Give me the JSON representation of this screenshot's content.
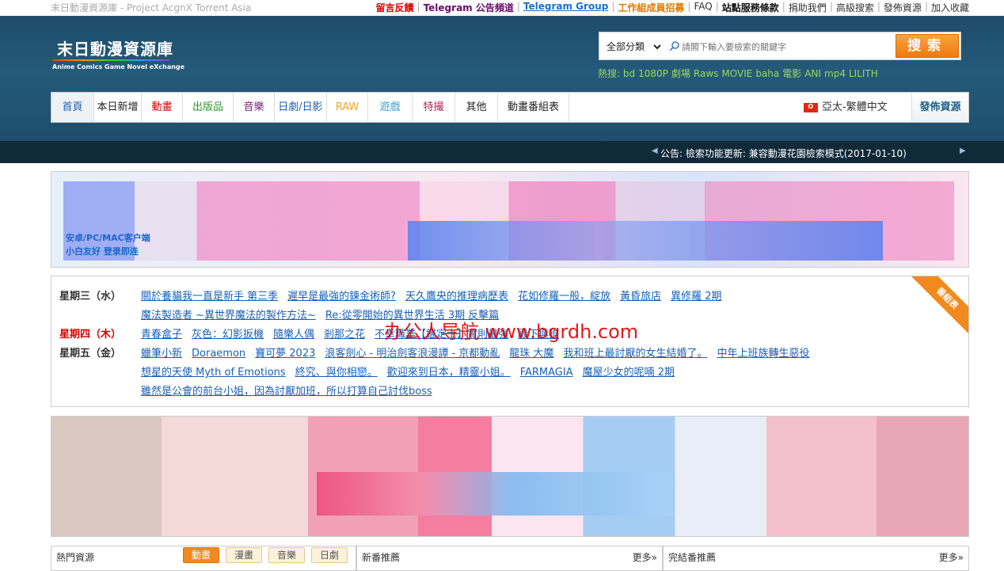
{
  "topbar": {
    "site_title": "末日動漫資源庫 - Project AcgnX Torrent Asia",
    "links": [
      {
        "label": "留言反饋",
        "style": "red"
      },
      {
        "label": "Telegram 公告頻道",
        "style": "purple"
      },
      {
        "label": "Telegram Group",
        "style": "blue"
      },
      {
        "label": "工作組成員招募",
        "style": "orange"
      },
      {
        "label": "FAQ",
        "style": "normal"
      },
      {
        "label": "站點服務條款",
        "style": "strong"
      },
      {
        "label": "捐助我們",
        "style": "normal"
      },
      {
        "label": "高級搜索",
        "style": "normal"
      },
      {
        "label": "發佈資源",
        "style": "normal"
      },
      {
        "label": "加入收藏",
        "style": "normal"
      }
    ]
  },
  "header": {
    "logo_cn": "末日動漫資源庫",
    "logo_en": "Anime Comics Game Novel eXchange",
    "search": {
      "category": "全部分類",
      "placeholder": "請閣下輸入要檢索的關鍵字",
      "button": "搜索"
    },
    "hot_label": "熱搜:",
    "hot_words": [
      "bd",
      "1080P",
      "劇場",
      "Raws",
      "MOVIE",
      "baha",
      "電影",
      "ANI",
      "mp4",
      "LILITH"
    ]
  },
  "nav": {
    "items": [
      {
        "label": "首頁",
        "color": "#1a5fb4"
      },
      {
        "label": "本日新增",
        "color": "#222222"
      },
      {
        "label": "動畫",
        "color": "#d00000"
      },
      {
        "label": "出版品",
        "color": "#2a9a2a"
      },
      {
        "label": "音樂",
        "color": "#7a1f7a"
      },
      {
        "label": "日劇/日影",
        "color": "#1a5fb4"
      },
      {
        "label": "RAW",
        "color": "#f5a623"
      },
      {
        "label": "遊戲",
        "color": "#3aa0d8"
      },
      {
        "label": "特撮",
        "color": "#b0224a"
      },
      {
        "label": "其他",
        "color": "#222222"
      },
      {
        "label": "動畫番組表",
        "color": "#222222"
      }
    ],
    "language": "亞太-繁體中文",
    "publish": "發佈資源"
  },
  "announcement": "公告: 檢索功能更新: 兼容動漫花園檢索模式(2017-01-10)",
  "banner1": {
    "client_line1": "安卓/PC/MAC客户端",
    "client_line2": "小白友好 登录即连"
  },
  "schedule": {
    "ribbon": "番組表",
    "watermark": "办公人导航 www.bgrdh.com",
    "days": [
      {
        "day": "星期三（水）",
        "today": false,
        "lines": [
          [
            "關於養貓我一直是新手 第三季",
            "遲早是最強的鍊金術師?",
            "天久鷹央的推理病歷表",
            "花如修羅一般，綻放",
            "黃昏旅店",
            "異修羅 2期"
          ],
          [
            "魔法製造者 ~異世界魔法的製作方法~",
            "Re:從零開始的異世界生活 3期 反擊篇"
          ]
        ]
      },
      {
        "day": "星期四（木）",
        "today": true,
        "lines": [
          [
            "青春盒子",
            "灰色：幻影扳機",
            "隨樂人偶",
            "剎那之花",
            "不幸職業【鑑定士】實則最強",
            "殿下與狗"
          ]
        ]
      },
      {
        "day": "星期五（金）",
        "today": false,
        "lines": [
          [
            "蠟筆小新",
            "Doraemon",
            "寶可夢 2023",
            "浪客劍心 - 明治劍客浪漫譚 - 京都動亂",
            "龍珠 大魔",
            "我和班上最討厭的女生結婚了。",
            "中年上班族轉生惡役"
          ],
          [
            "想星的天使 Myth of Emotions",
            "終究、與你相戀。",
            "歡迎來到日本，精靈小姐。",
            "FARMAGIA",
            "魔屋少女的呢喃 2期"
          ],
          [
            "雖然是公會的前台小姐，因為討厭加班，所以打算自己討伐boss"
          ]
        ]
      }
    ]
  },
  "panels": {
    "hot": {
      "title": "熱門資源",
      "tabs": [
        "動畫",
        "漫畫",
        "音樂",
        "日劇"
      ],
      "active_tab": "動畫"
    },
    "new": {
      "title": "新番推薦",
      "more": "更多»"
    },
    "finished": {
      "title": "完結番推薦",
      "more": "更多»"
    }
  },
  "colors": {
    "accent_orange": "#f08a1c",
    "header_blue": "#245a7a",
    "link_blue": "#1a5fb4",
    "hot_green": "#9cd85a"
  }
}
